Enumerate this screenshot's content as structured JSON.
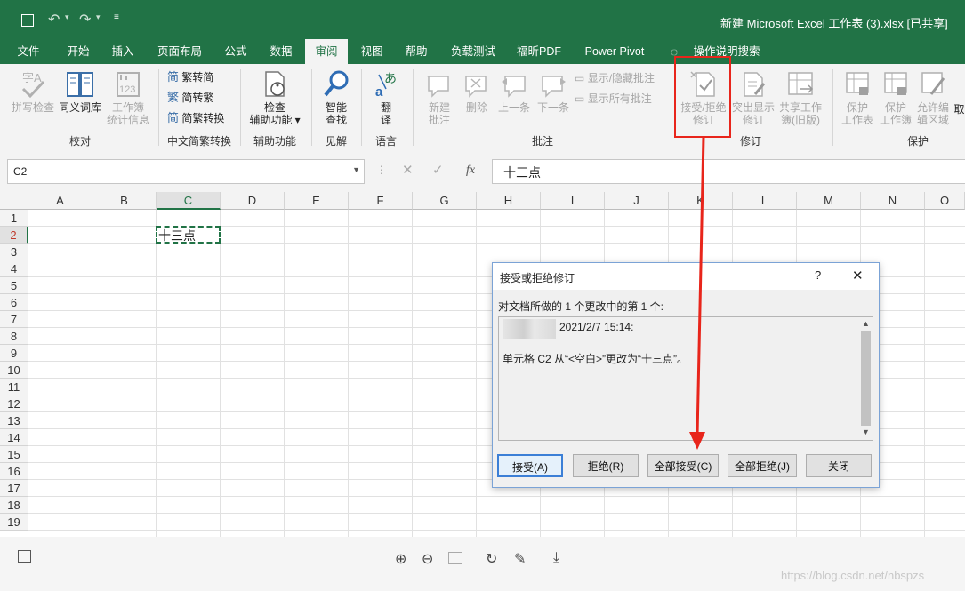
{
  "title_bar": {
    "title": "新建 Microsoft Excel 工作表 (3).xlsx  [已共享]"
  },
  "tabs": [
    "文件",
    "开始",
    "插入",
    "页面布局",
    "公式",
    "数据",
    "审阅",
    "视图",
    "帮助",
    "负载测试",
    "福昕PDF",
    "Power Pivot"
  ],
  "active_tab": "审阅",
  "search_label": "操作说明搜索",
  "ribbon": {
    "spell_check": "拼写检查",
    "thesaurus": "同义词库",
    "workbook_stats": [
      "工作簿",
      "统计信息"
    ],
    "group_proofing": "校对",
    "trad_to_simp": "繁转简",
    "simp_to_trad": "简转繁",
    "simp_trad_convert": "简繁转换",
    "group_chinese": "中文简繁转换",
    "check_access": [
      "检查",
      "辅助功能"
    ],
    "group_access": "辅助功能",
    "smart_lookup": [
      "智能",
      "查找"
    ],
    "group_insights": "见解",
    "translate": [
      "翻",
      "译"
    ],
    "group_language": "语言",
    "new_comment": [
      "新建",
      "批注"
    ],
    "delete": "删除",
    "previous": "上一条",
    "next": "下一条",
    "show_hide_comments": "显示/隐藏批注",
    "show_all_comments": "显示所有批注",
    "group_comments": "批注",
    "accept_reject": [
      "接受/拒绝",
      "修订"
    ],
    "highlight_changes": [
      "突出显示",
      "修订"
    ],
    "share_workbook": [
      "共享工作",
      "簿(旧版)"
    ],
    "group_changes": "修订",
    "protect_sheet": [
      "保护",
      "工作表"
    ],
    "protect_workbook": [
      "保护",
      "工作簿"
    ],
    "allow_edit": [
      "允许编",
      "辑区域"
    ],
    "group_protect": "保护",
    "partial_share": "取"
  },
  "formula_bar": {
    "name_box": "C2",
    "fx": "fx",
    "content": "十三点"
  },
  "columns": [
    "A",
    "B",
    "C",
    "D",
    "E",
    "F",
    "G",
    "H",
    "I",
    "J",
    "K",
    "L",
    "M",
    "N",
    "O"
  ],
  "rows": [
    "1",
    "2",
    "3",
    "4",
    "5",
    "6",
    "7",
    "8",
    "9",
    "10",
    "11",
    "12",
    "13",
    "14",
    "15",
    "16",
    "17",
    "18",
    "19"
  ],
  "cell_c2": "十三点",
  "dialog": {
    "title": "接受或拒绝修订",
    "help": "?",
    "close": "✕",
    "info": "对文档所做的 1 个更改中的第 1 个:",
    "timestamp": "2021/2/7 15:14:",
    "change_text": "单元格 C2 从“<空白>”更改为“十三点”。",
    "buttons": {
      "accept": "接受(A)",
      "reject": "拒绝(R)",
      "accept_all": "全部接受(C)",
      "reject_all": "全部拒绝(J)",
      "close": "关闭"
    }
  },
  "watermark": "https://blog.csdn.net/nbspzs",
  "colors": {
    "excel_green": "#217346",
    "annotation_red": "#e8251b"
  }
}
